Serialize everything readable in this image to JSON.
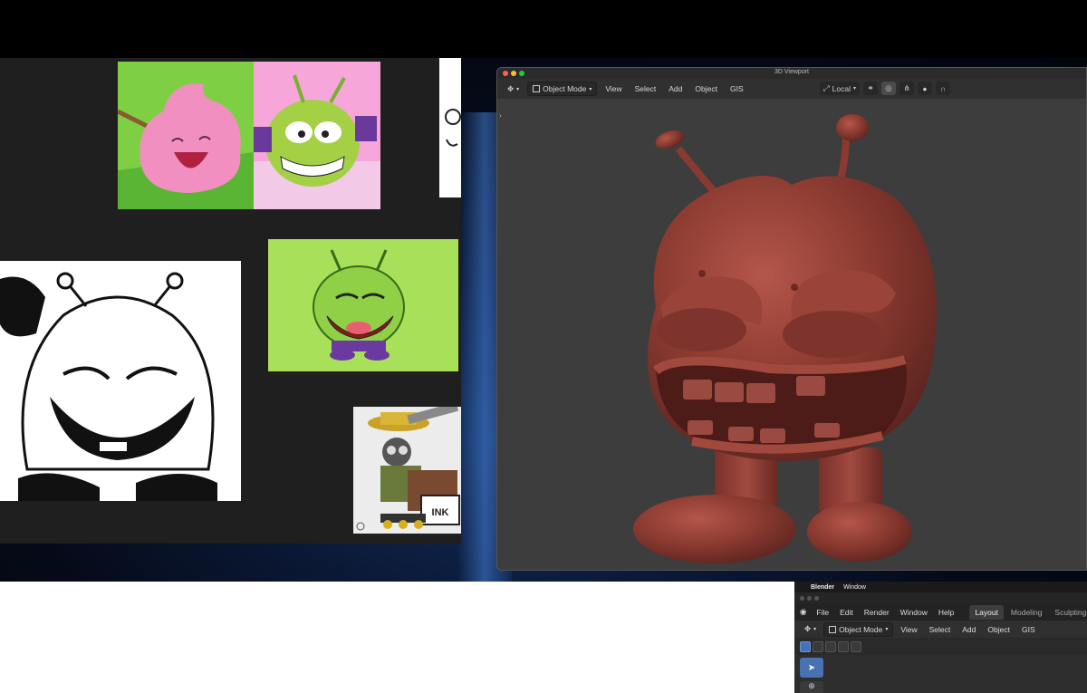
{
  "viewport_window": {
    "title": "3D Viewport",
    "mode": "Object Mode",
    "menus": [
      "View",
      "Select",
      "Add",
      "Object",
      "GIS"
    ],
    "transform_orientation": "Local"
  },
  "blender_main": {
    "app_menu": "Blender",
    "window_menu": "Window",
    "menus": [
      "File",
      "Edit",
      "Render",
      "Window",
      "Help"
    ],
    "workspace_tabs": [
      "Layout",
      "Modeling",
      "Sculpting"
    ],
    "active_tab": "Layout",
    "mode": "Object Mode",
    "header_menus": [
      "View",
      "Select",
      "Add",
      "Object",
      "GIS"
    ]
  },
  "references": {
    "stamp_text": "INK"
  },
  "colors": {
    "sculpt_clay": "#8a3a30",
    "viewport_bg": "#3d3d3d",
    "lime_bg": "#a8e05a",
    "accent_blue": "#4772b3"
  }
}
